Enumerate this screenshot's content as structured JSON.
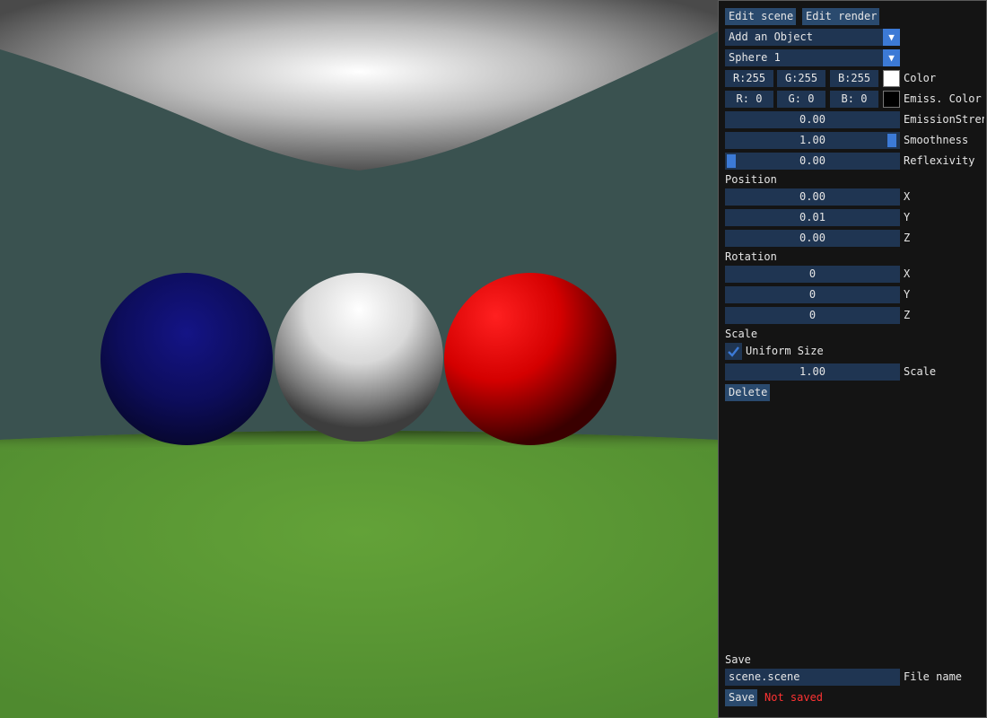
{
  "toolbar": {
    "edit_scene": "Edit scene",
    "edit_render": "Edit render"
  },
  "add_object": {
    "value": "Add an Object"
  },
  "object_select": {
    "value": "Sphere 1"
  },
  "color": {
    "r": "R:255",
    "g": "G:255",
    "b": "B:255",
    "label": "Color",
    "swatch": "#ffffff"
  },
  "emission_color": {
    "r": "R:  0",
    "g": "G:  0",
    "b": "B:  0",
    "label": "Emiss. Color",
    "swatch": "#000000"
  },
  "emission_strength": {
    "value": "0.00",
    "label": "EmissionStren"
  },
  "smoothness": {
    "value": "1.00",
    "label": "Smoothness",
    "level": 1.0
  },
  "reflexivity": {
    "value": "0.00",
    "label": "Reflexivity",
    "level": 0.0
  },
  "position": {
    "title": "Position",
    "x": "0.00",
    "y": "0.01",
    "z": "0.00",
    "x_label": "X",
    "y_label": "Y",
    "z_label": "Z"
  },
  "rotation": {
    "title": "Rotation",
    "x": "0",
    "y": "0",
    "z": "0",
    "x_label": "X",
    "y_label": "Y",
    "z_label": "Z"
  },
  "scale": {
    "title": "Scale",
    "uniform_label": "Uniform Size",
    "uniform_checked": true,
    "value": "1.00",
    "label": "Scale"
  },
  "delete_label": "Delete",
  "save": {
    "title": "Save",
    "filename": "scene.scene",
    "filename_label": "File name",
    "button": "Save",
    "status": "Not saved"
  },
  "scene": {
    "wall": "#3a5250",
    "floor": "#5f9a37",
    "spheres": [
      "#1a1a8a",
      "#ffffff",
      "#ff0000"
    ]
  }
}
